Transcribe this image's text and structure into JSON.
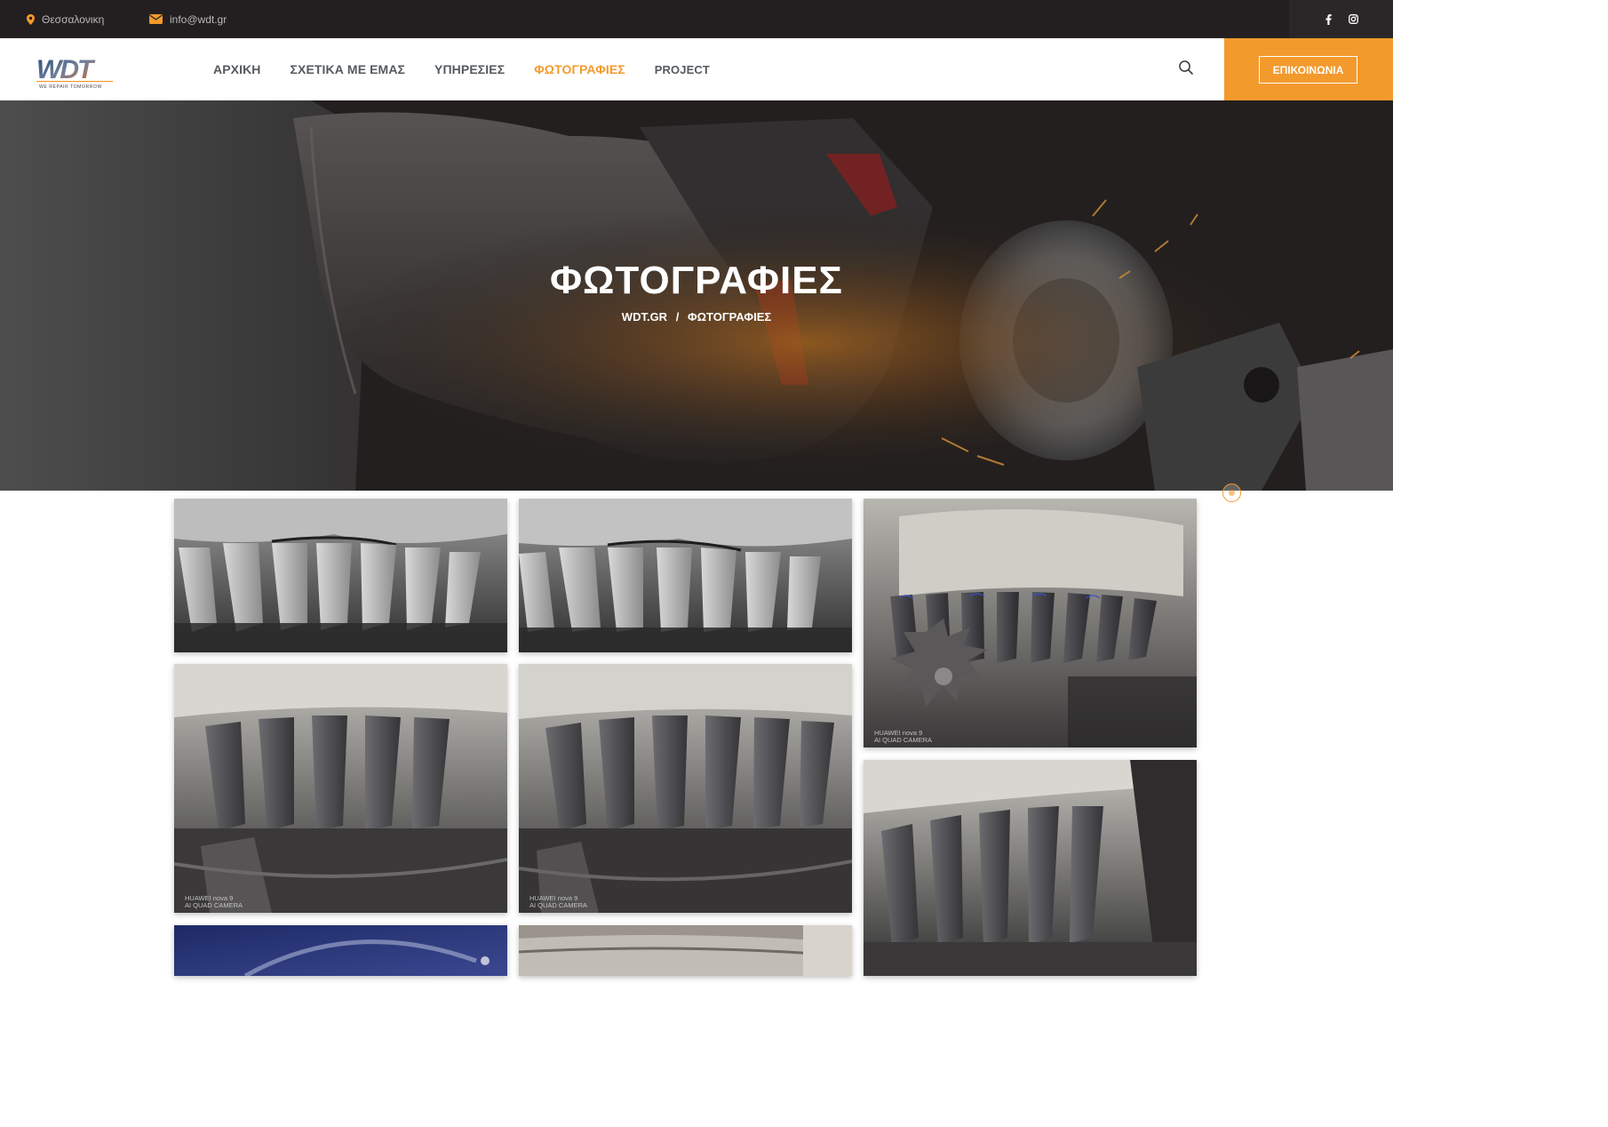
{
  "topbar": {
    "location": "Θεσσαλονικη",
    "email": "info@wdt.gr",
    "social": [
      "facebook-icon",
      "instagram-icon"
    ]
  },
  "header": {
    "logo_text": "WDT",
    "logo_tagline": "WE REPAIR TOMORROW",
    "nav": [
      "ΑΡΧΙΚΗ",
      "ΣΧΕΤΙΚΑ ΜΕ ΕΜΑΣ",
      "ΥΠΗΡΕΣΙΕΣ",
      "ΦΩΤΟΓΡΑΦΙΕΣ",
      "PROJECT"
    ],
    "active_nav": "ΦΩΤΟΓΡΑΦΙΕΣ",
    "cta": "ΕΠΙΚΟΙΝΩΝΙΑ"
  },
  "hero": {
    "title": "ΦΩΤΟΓΡΑΦΙΕΣ",
    "breadcrumb_home": "WDT.GR",
    "breadcrumb_sep": "/",
    "breadcrumb_current": "ΦΩΤΟΓΡΑΦΙΕΣ"
  },
  "gallery": {
    "watermark_line1": "HUAWEI nova 9",
    "watermark_line2": "AI QUAD CAMERA"
  },
  "colors": {
    "accent": "#f39a2c",
    "topbar": "#231f20",
    "nav_text": "#555a5f"
  }
}
